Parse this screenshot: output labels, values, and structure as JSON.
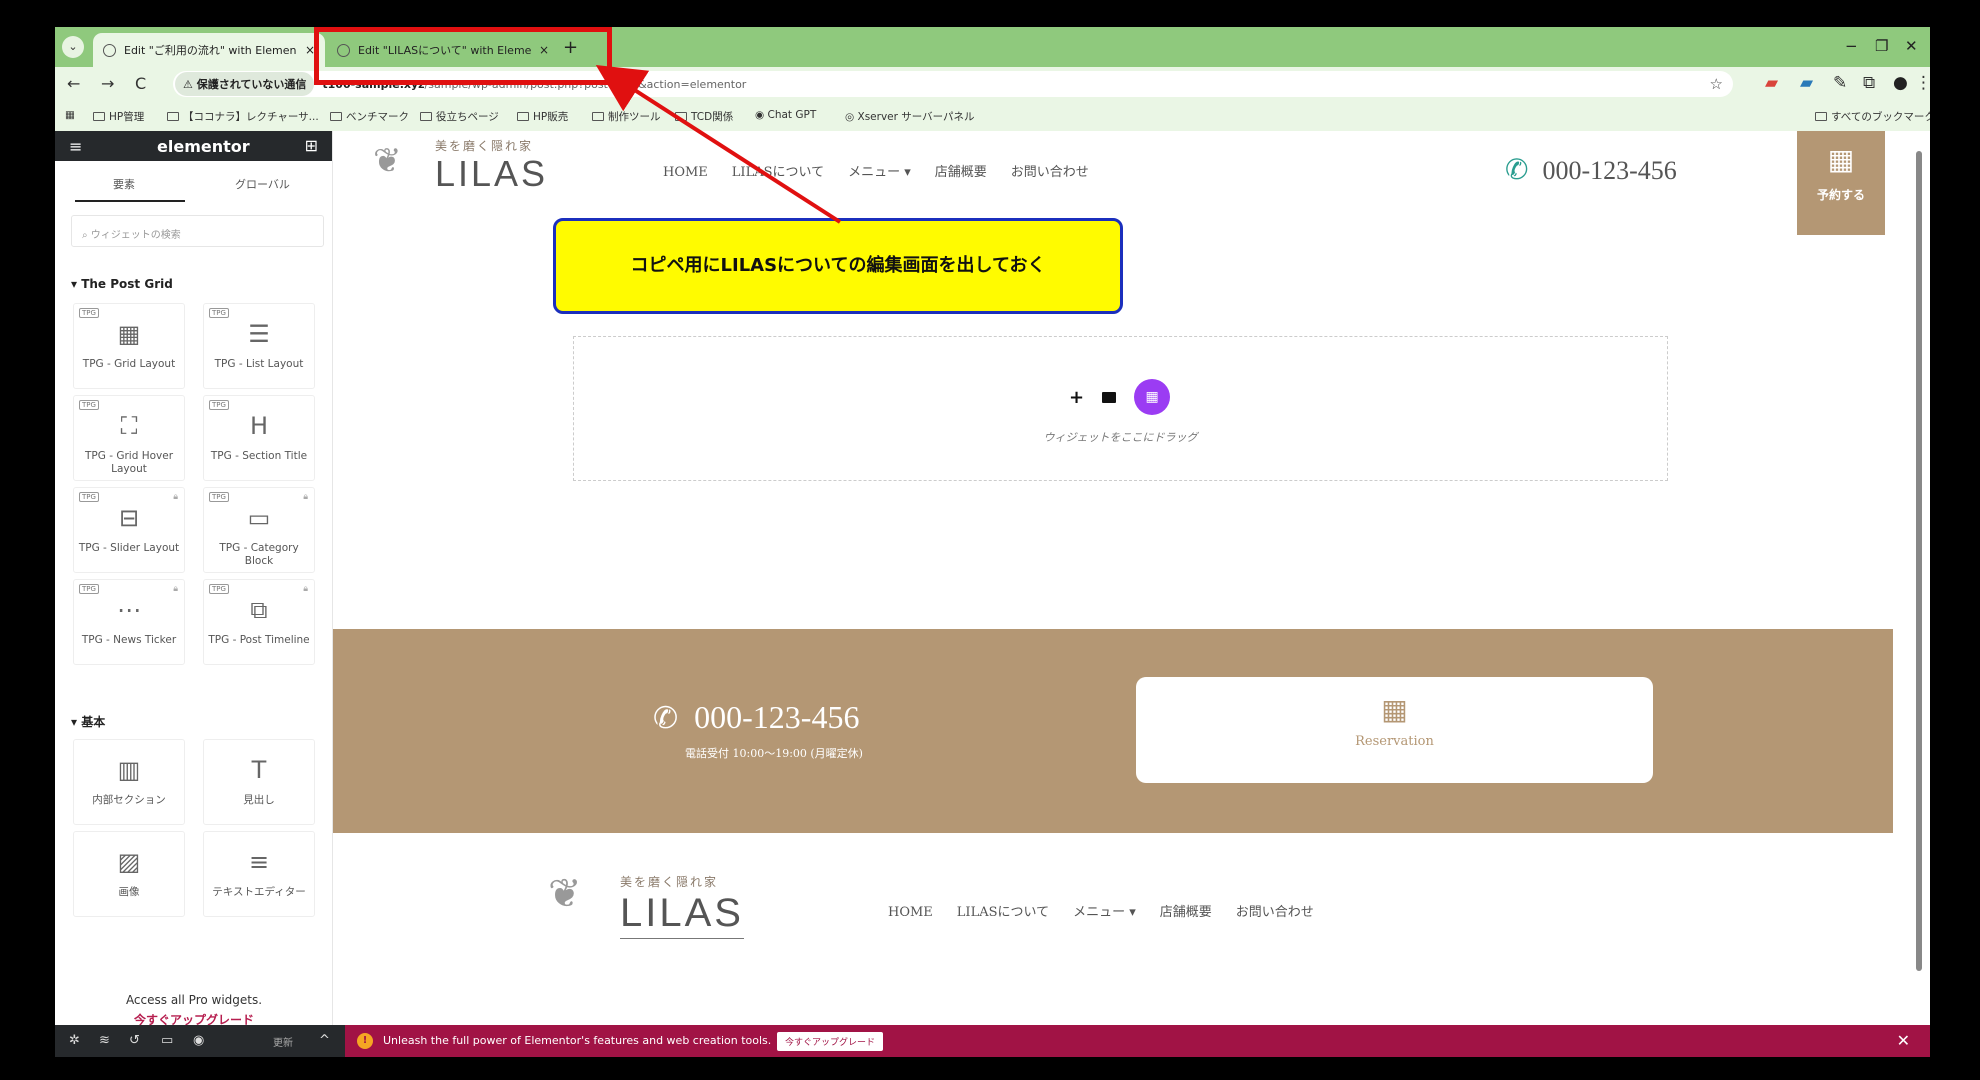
{
  "browser": {
    "tabs": [
      {
        "label": "Edit \"ご利用の流れ\" with Elemen",
        "close": "×"
      },
      {
        "label": "Edit \"LILASについて\" with Elemen",
        "close": "×"
      }
    ],
    "new_tab": "+",
    "window_controls": {
      "minimize": "−",
      "restore": "❐",
      "close": "✕"
    },
    "nav": {
      "back": "←",
      "forward": "→",
      "reload": "C"
    },
    "security_label": "⚠ 保護されていない通信",
    "url_host": "t100-sample.xyz",
    "url_path": "/sample/wp-admin/post.php?post=231&action=elementor",
    "star": "☆",
    "bookmarks": [
      "HP管理",
      "【ココナラ】レクチャーサ...",
      "ベンチマーク",
      "役立ちページ",
      "HP販売",
      "制作ツール",
      "TCD関係",
      "Chat GPT",
      "Xserver サーバーパネル"
    ],
    "all_bookmarks": "すべてのブックマーク"
  },
  "panel": {
    "logo": "elementor",
    "tabs": [
      "要素",
      "グローバル"
    ],
    "search_placeholder": "ウィジェットの検索",
    "section_post_grid": "▾ The Post Grid",
    "post_grid_widgets": [
      {
        "label": "TPG - Grid Layout",
        "icon": "grid-icon",
        "glyph": "▦",
        "locked": false
      },
      {
        "label": "TPG - List Layout",
        "icon": "list-icon",
        "glyph": "☰",
        "locked": false
      },
      {
        "label": "TPG - Grid Hover Layout",
        "icon": "image-hover-icon",
        "glyph": "⛶",
        "locked": false
      },
      {
        "label": "TPG - Section Title",
        "icon": "heading-h-icon",
        "glyph": "H",
        "locked": false
      },
      {
        "label": "TPG - Slider Layout",
        "icon": "slider-icon",
        "glyph": "⊟",
        "locked": true
      },
      {
        "label": "TPG - Category Block",
        "icon": "folder-icon",
        "glyph": "▭",
        "locked": true
      },
      {
        "label": "TPG - News Ticker",
        "icon": "ticker-icon",
        "glyph": "⋯",
        "locked": true
      },
      {
        "label": "TPG - Post Timeline",
        "icon": "timeline-icon",
        "glyph": "⧉",
        "locked": true
      }
    ],
    "section_basic": "▾ 基本",
    "basic_widgets": [
      {
        "label": "内部セクション",
        "icon": "inner-section-icon",
        "glyph": "▥"
      },
      {
        "label": "見出し",
        "icon": "heading-icon",
        "glyph": "T"
      },
      {
        "label": "画像",
        "icon": "image-icon",
        "glyph": "▨"
      },
      {
        "label": "テキストエディター",
        "icon": "text-editor-icon",
        "glyph": "≡"
      }
    ],
    "pro_text": "Access all Pro widgets.",
    "pro_link": "今すぐアップグレード",
    "footer_update": "更新"
  },
  "site": {
    "logo_tag": "美を磨く隠れ家",
    "logo": "LILAS",
    "nav": [
      "HOME",
      "LILASについて",
      "メニュー ▾",
      "店舗概要",
      "お問い合わせ"
    ],
    "phone": "000-123-456",
    "reserve_label": "予約する",
    "dropzone_text": "ウィジェットをここにドラッグ",
    "band_phone": "000-123-456",
    "band_hours": "電話受付 10:00〜19:00 (月曜定休)",
    "reservation_label": "Reservation",
    "footer_logo_tag": "美を磨く隠れ家",
    "footer_logo": "LILAS",
    "footer_nav": [
      "HOME",
      "LILASについて",
      "メニュー ▾",
      "店舗概要",
      "お問い合わせ"
    ]
  },
  "promo": {
    "text": "Unleash the full power of Elementor's features and web creation tools.",
    "button": "今すぐアップグレード",
    "close": "✕"
  },
  "annotation": {
    "callout": "コピペ用にLILASについての編集画面を出しておく",
    "highlight_color": "#e01010",
    "callout_bg": "#fffb00"
  }
}
